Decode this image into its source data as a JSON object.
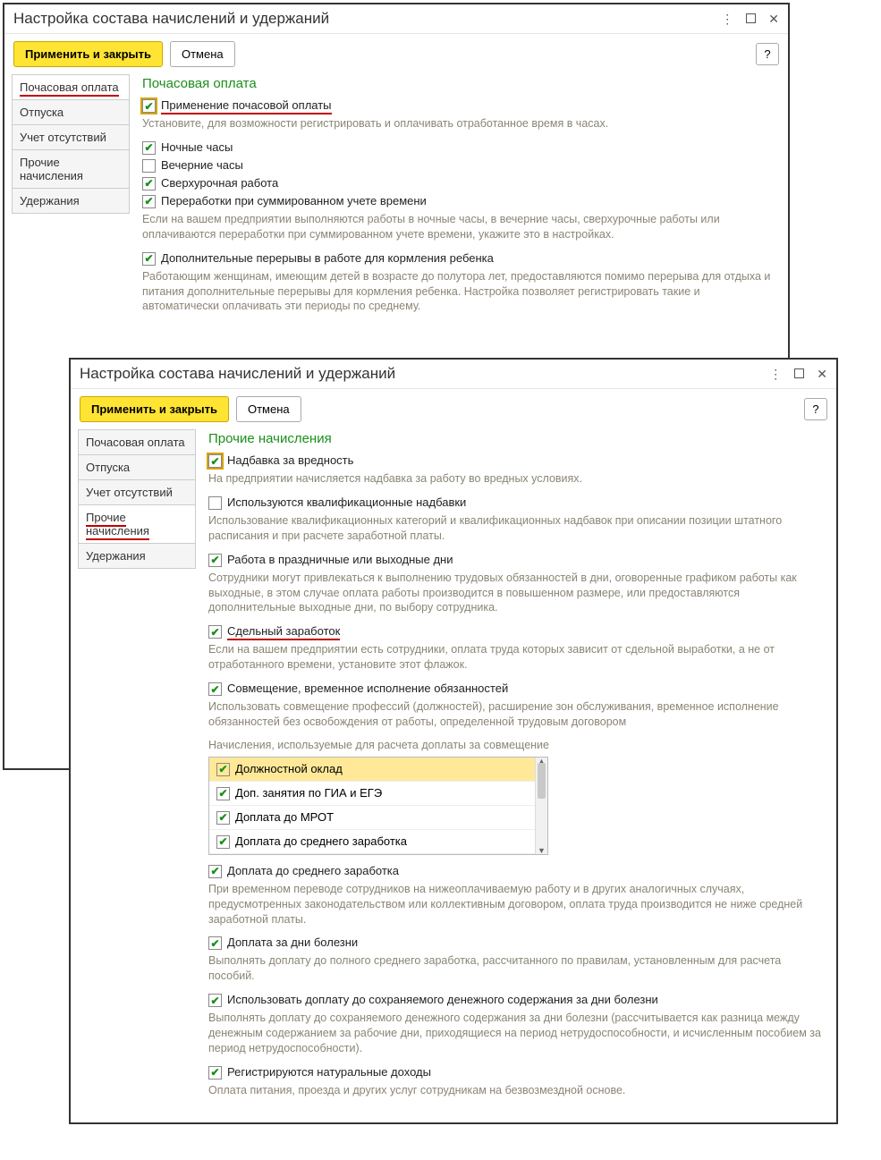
{
  "window1": {
    "title": "Настройка состава начислений и удержаний",
    "apply": "Применить и закрыть",
    "cancel": "Отмена",
    "help": "?",
    "tabs": {
      "hourly": "Почасовая оплата",
      "vac": "Отпуска",
      "absence": "Учет отсутствий",
      "other": "Прочие начисления",
      "ded": "Удержания"
    },
    "section": "Почасовая оплата",
    "opt_hourly": "Применение почасовой оплаты",
    "desc_hourly": "Установите, для возможности регистрировать и оплачивать отработанное время в часах.",
    "opt_night": "Ночные часы",
    "opt_evening": "Вечерние часы",
    "opt_overtime": "Сверхурочная работа",
    "opt_sum": "Переработки при суммированном учете времени",
    "desc_sum": "Если на вашем предприятии выполняются работы в ночные часы, в вечерние часы, сверхурочные работы или оплачиваются переработки при суммированном учете времени, укажите это в настройках.",
    "opt_breaks": "Дополнительные перерывы в работе для кормления ребенка",
    "desc_breaks": "Работающим женщинам, имеющим детей в возрасте до полутора лет, предоставляются помимо перерыва для отдыха и питания дополнительные перерывы для кормления ребенка. Настройка позволяет регистрировать такие и автоматически оплачивать эти периоды по среднему."
  },
  "window2": {
    "title": "Настройка состава начислений и удержаний",
    "apply": "Применить и закрыть",
    "cancel": "Отмена",
    "help": "?",
    "tabs": {
      "hourly": "Почасовая оплата",
      "vac": "Отпуска",
      "absence": "Учет отсутствий",
      "other": "Прочие начисления",
      "ded": "Удержания"
    },
    "section": "Прочие начисления",
    "opt_harm": "Надбавка за вредность",
    "desc_harm": "На предприятии начисляется надбавка за работу во вредных условиях.",
    "opt_qual": "Используются квалификационные надбавки",
    "desc_qual": "Использование квалификационных категорий и квалификационных надбавок при описании позиции штатного расписания и при расчете заработной платы.",
    "opt_holiday": "Работа в праздничные или выходные дни",
    "desc_holiday": "Сотрудники могут привлекаться к выполнению трудовых обязанностей в дни, оговоренные графиком работы как выходные, в этом случае оплата работы производится в повышенном размере, или предоставляются дополнительные выходные дни, по выбору сотрудника.",
    "opt_piece": "Сдельный заработок",
    "desc_piece": "Если на вашем предприятии есть сотрудники, оплата труда которых зависит от сдельной выработки, а не от отработанного времени, установите этот флажок.",
    "opt_combine": "Совмещение, временное исполнение обязанностей",
    "desc_combine": "Использовать совмещение профессий (должностей), расширение зон обслуживания, временное исполнение обязанностей без освобождения от работы, определенной трудовым договором",
    "list_head": "Начисления, используемые для расчета доплаты за совмещение",
    "list": {
      "a": "Должностной оклад",
      "b": "Доп. занятия по ГИА и ЕГЭ",
      "c": "Доплата до МРОТ",
      "d": "Доплата до среднего заработка"
    },
    "opt_avg": "Доплата до среднего заработка",
    "desc_avg": "При временном переводе сотрудников на нижеоплачиваемую работу и в других аналогичных случаях, предусмотренных законодательством или коллективным договором, оплата труда производится не ниже средней заработной платы.",
    "opt_sick": "Доплата за дни болезни",
    "desc_sick": "Выполнять доплату до полного среднего заработка, рассчитанного по правилам, установленным для расчета пособий.",
    "opt_save": "Использовать доплату до сохраняемого денежного содержания за дни болезни",
    "desc_save": "Выполнять доплату до сохраняемого денежного содержания за дни болезни (рассчитывается как разница между денежным содержанием за рабочие дни, приходящиеся на период нетрудоспособности, и исчисленным пособием за период нетрудоспособности).",
    "opt_nat": "Регистрируются натуральные доходы",
    "desc_nat": "Оплата питания, проезда и других услуг сотрудникам на безвозмездной основе."
  }
}
